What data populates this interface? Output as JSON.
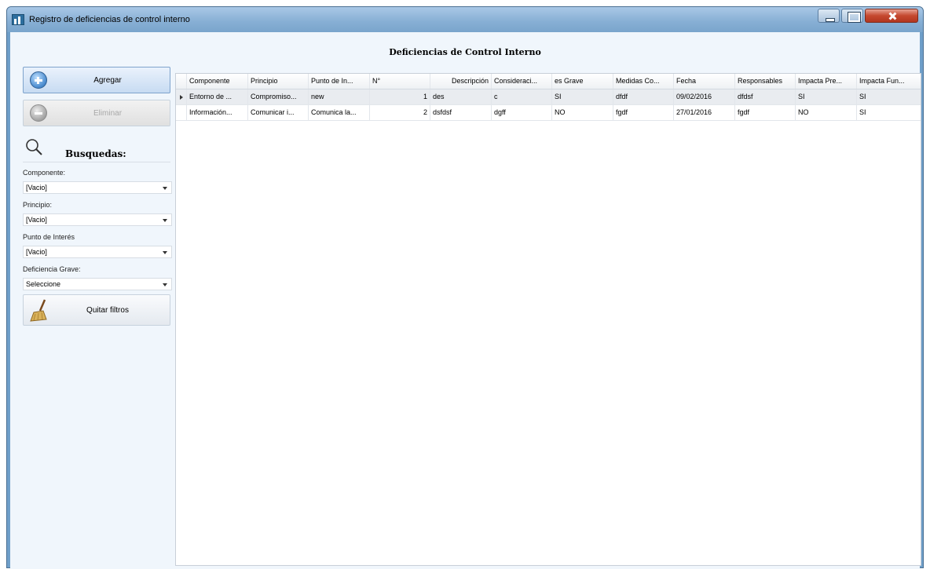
{
  "window": {
    "title": "Registro de deficiencias de control interno",
    "controls": [
      "minimize",
      "maximize",
      "close"
    ]
  },
  "form": {
    "title": "Deficiencias de Control Interno"
  },
  "sidebar": {
    "agregar_label": "Agregar",
    "eliminar_label": "Eliminar",
    "search_title": "Busquedas:",
    "filters": [
      {
        "label": "Componente:",
        "value": "[Vacio]"
      },
      {
        "label": "Principio:",
        "value": "[Vacio]"
      },
      {
        "label": "Punto de Interés",
        "value": "[Vacio]"
      },
      {
        "label": "Deficiencia Grave:",
        "value": "Seleccione"
      }
    ],
    "quitar_label": "Quitar filtros"
  },
  "grid": {
    "columns": [
      "Componente",
      "Principio",
      "Punto de In...",
      "N°",
      "Descripción",
      "Consideraci...",
      "es Grave",
      "Medidas Co...",
      "Fecha",
      "Responsables",
      "Impacta Pre...",
      "Impacta Fun..."
    ],
    "rows": [
      [
        "Entorno de ...",
        "Compromiso...",
        "new",
        "1",
        "des",
        "c",
        "SI",
        "dfdf",
        "09/02/2016",
        "dfdsf",
        "SI",
        "SI"
      ],
      [
        "Información...",
        "Comunicar i...",
        "Comunica la...",
        "2",
        "dsfdsf",
        "dgff",
        "NO",
        "fgdf",
        "27/01/2016",
        "fgdf",
        "NO",
        "SI"
      ]
    ],
    "selected_row": 0
  },
  "colors": {
    "title_bar": "#86aed4",
    "client_background": "#f0f6fc",
    "selected_row": "#e9ecf0",
    "close_button": "#c5482f"
  },
  "icons": {
    "app": "app-chart-icon",
    "agregar": "plus-circle-icon",
    "eliminar": "minus-circle-icon",
    "search": "magnifier-icon",
    "quitar": "broom-icon"
  }
}
